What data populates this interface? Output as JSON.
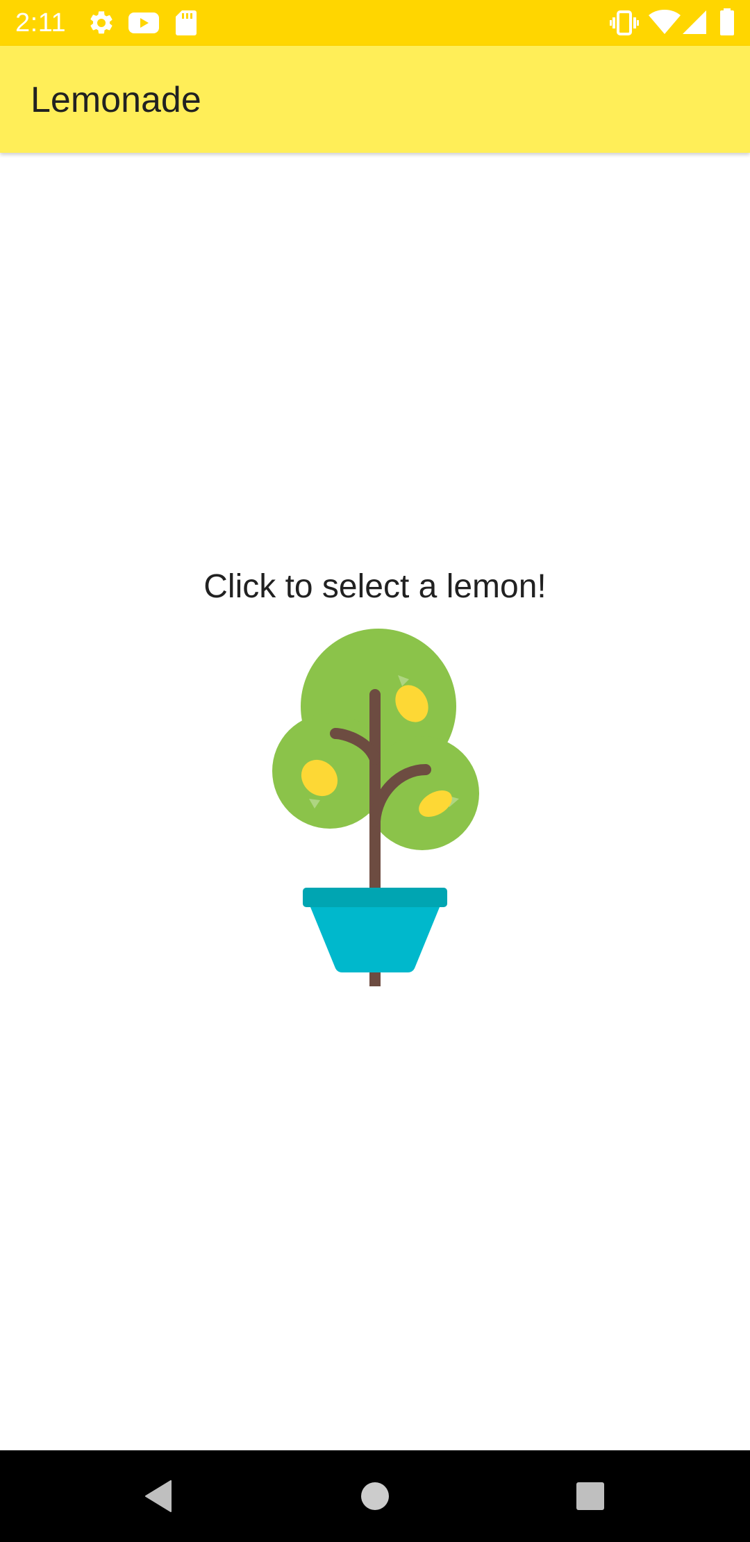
{
  "status_bar": {
    "time": "2:11",
    "background": "#ffd600",
    "left_icons": [
      "settings-icon",
      "youtube-icon",
      "sd-card-icon"
    ],
    "right_icons": [
      "vibrate-icon",
      "wifi-icon",
      "signal-icon",
      "battery-icon"
    ]
  },
  "app_bar": {
    "title": "Lemonade",
    "background": "#ffee58"
  },
  "main": {
    "prompt": "Click to select a lemon!",
    "image_name": "lemon-tree-icon"
  },
  "nav_bar": {
    "buttons": [
      "back-icon",
      "home-icon",
      "recents-icon"
    ],
    "background": "#000000"
  }
}
